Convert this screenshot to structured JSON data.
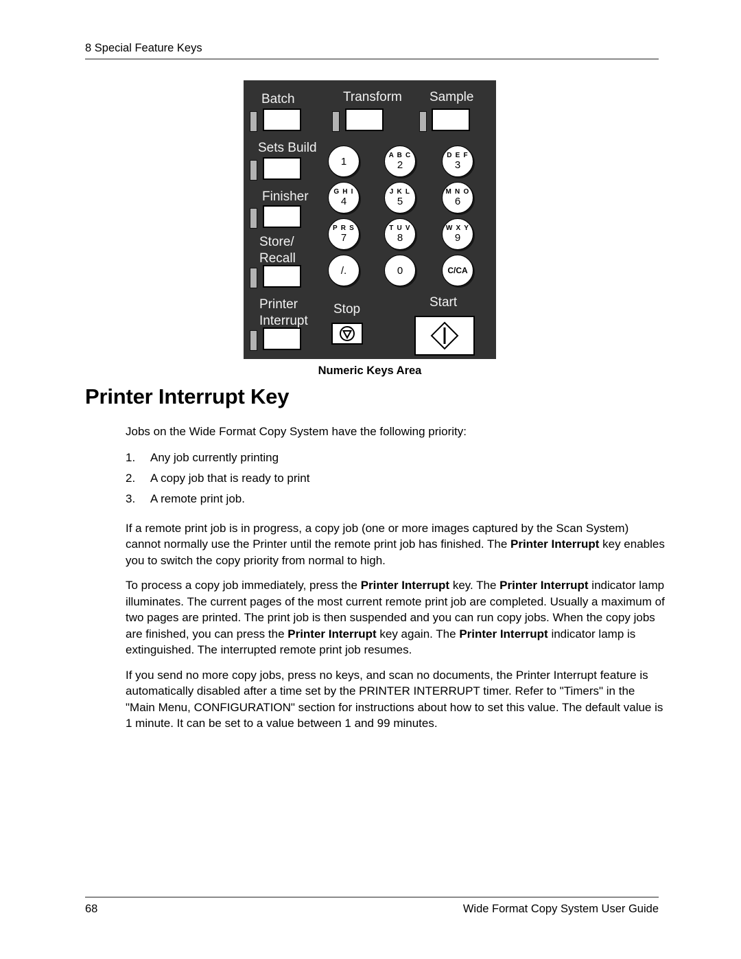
{
  "header": {
    "running_head": "8 Special Feature Keys"
  },
  "figure": {
    "caption": "Numeric Keys Area",
    "feature_keys": [
      {
        "label": "Batch",
        "lamp": "indicator-lamp"
      },
      {
        "label": "Transform",
        "lamp": "indicator-lamp"
      },
      {
        "label": "Sample",
        "lamp": "indicator-lamp"
      },
      {
        "label": "Sets Build",
        "lamp": "indicator-lamp"
      },
      {
        "label": "Finisher",
        "lamp": "indicator-lamp"
      },
      {
        "label": "Store/",
        "label2": "Recall",
        "lamp": "indicator-lamp"
      },
      {
        "label": "Printer",
        "label2": "Interrupt",
        "lamp": "indicator-lamp"
      }
    ],
    "numeric_keys": [
      {
        "letters": "",
        "digit": "1"
      },
      {
        "letters": "A B C",
        "digit": "2"
      },
      {
        "letters": "D E F",
        "digit": "3"
      },
      {
        "letters": "G H I",
        "digit": "4"
      },
      {
        "letters": "J K L",
        "digit": "5"
      },
      {
        "letters": "M N O",
        "digit": "6"
      },
      {
        "letters": "P R S",
        "digit": "7"
      },
      {
        "letters": "T U V",
        "digit": "8"
      },
      {
        "letters": "W X Y",
        "digit": "9"
      },
      {
        "letters": "",
        "digit": "/."
      },
      {
        "letters": "",
        "digit": "0"
      },
      {
        "letters": "",
        "digit": "C/CA"
      }
    ],
    "stop_label": "Stop",
    "start_label": "Start",
    "panel_color": "#333333",
    "lamp_color": "#b3b3b3",
    "key_color": "#ffffff"
  },
  "section": {
    "title": "Printer Interrupt Key",
    "intro": "Jobs on the Wide Format Copy System have the following priority:",
    "priority_list": [
      {
        "num": "1.",
        "text": "Any job currently printing"
      },
      {
        "num": "2.",
        "text": "A copy job that is ready to print"
      },
      {
        "num": "3.",
        "text": "A remote print job."
      }
    ],
    "para2_a": "If a remote print job is in progress, a copy job (one or more images captured by the Scan System) cannot normally use the Printer until the remote print job has finished.  The ",
    "para2_b": "Printer Interrupt",
    "para2_c": " key enables you to switch the copy priority from normal to high.",
    "para3_a": "To process a copy job immediately, press the ",
    "para3_b": "Printer Interrupt",
    "para3_c": " key.  The ",
    "para3_d": "Printer Interrupt",
    "para3_e": " indicator lamp illuminates. The current pages of the most current remote print job are completed. Usually a maximum of two pages are printed. The print job is then suspended and you can run copy jobs. When the copy jobs are finished, you can press the ",
    "para3_f": "Printer Interrupt",
    "para3_g": " key again.  The ",
    "para3_h": "Printer Interrupt",
    "para3_i": " indicator lamp is extinguished.  The interrupted remote print job resumes.",
    "para4": "If you send no more copy jobs, press no keys, and scan no documents, the Printer Interrupt feature is automatically disabled after a time set by the PRINTER INTERRUPT timer.  Refer to \"Timers\" in the \"Main Menu, CONFIGURATION\" section for instructions about how to set this value.  The default value is 1 minute.  It can be set to a value between 1 and 99 minutes."
  },
  "footer": {
    "page_number": "68",
    "guide_title": "Wide Format Copy System User Guide"
  }
}
